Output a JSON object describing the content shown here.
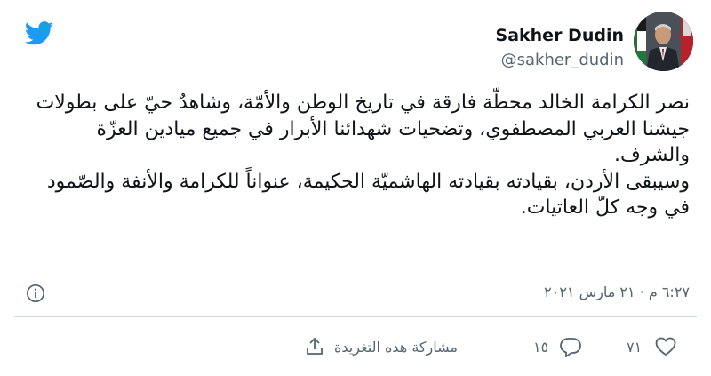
{
  "user": {
    "name": "Sakher Dudin",
    "handle": "@sakher_dudin"
  },
  "tweet": {
    "paragraph1": "نصر الكرامة الخالد محطّة فارقة في تاريخ الوطن والأمّة، وشاهدٌ حيّ على بطولات جيشنا العربي المصطفوي، وتضحيات شهدائنا الأبرار في جميع ميادين العزّة والشرف.",
    "paragraph2": "وسيبقى الأردن، بقيادته بقيادته الهاشميّة الحكيمة، عنواناً للكرامة والأنفة والصّمود في وجه كلّ العاتيات.",
    "timestamp": "٦:٢٧ م · ٢١ مارس ٢٠٢١"
  },
  "actions": {
    "likes": "٧١",
    "replies": "١٥",
    "share_label": "مشاركة هذه التغريدة"
  },
  "colors": {
    "brand": "#1d9bf0",
    "text": "#0f1419",
    "muted": "#536471"
  },
  "icons": [
    "twitter-bird-icon",
    "info-icon",
    "heart-icon",
    "reply-icon",
    "share-icon"
  ]
}
